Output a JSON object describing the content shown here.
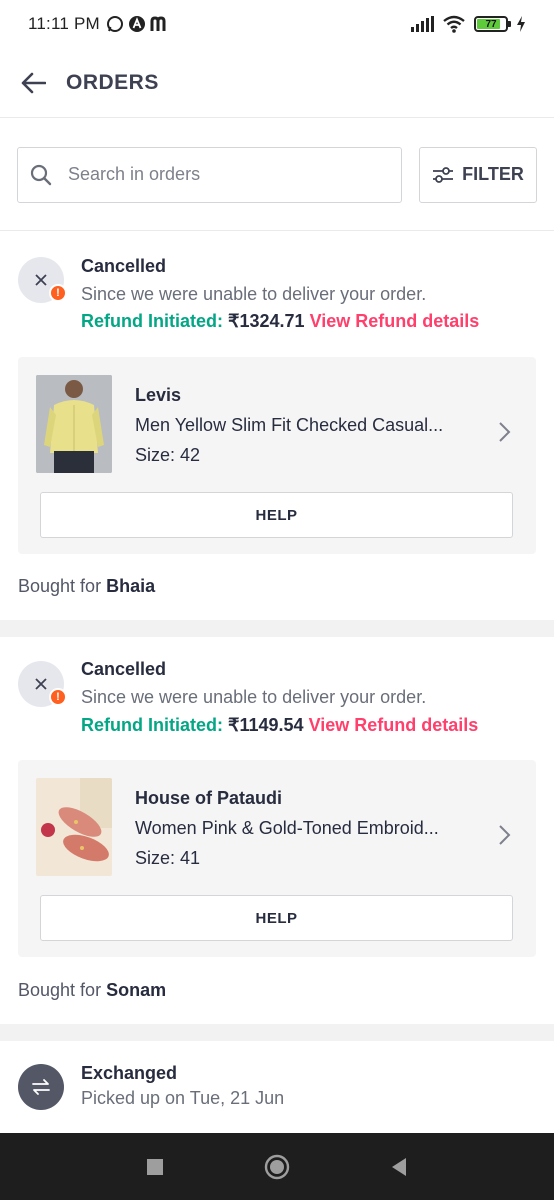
{
  "status_bar": {
    "time": "11:11 PM",
    "battery": "77"
  },
  "appbar": {
    "title": "ORDERS"
  },
  "search": {
    "placeholder": "Search in orders"
  },
  "filter": {
    "label": "FILTER"
  },
  "orders": [
    {
      "status": "Cancelled",
      "subtitle": "Since we were unable to deliver your order.",
      "refund_label": "Refund Initiated:",
      "refund_amount": "₹1324.71",
      "refund_link": "View Refund details",
      "brand": "Levis",
      "product": "Men Yellow Slim Fit Checked Casual...",
      "size": "Size: 42",
      "help": "HELP",
      "bought_for_label": "Bought for",
      "bought_for_name": "Bhaia"
    },
    {
      "status": "Cancelled",
      "subtitle": "Since we were unable to deliver your order.",
      "refund_label": "Refund Initiated:",
      "refund_amount": "₹1149.54",
      "refund_link": "View Refund details",
      "brand": "House of Pataudi",
      "product": "Women Pink & Gold-Toned Embroid...",
      "size": "Size: 41",
      "help": "HELP",
      "bought_for_label": "Bought for",
      "bought_for_name": "Sonam"
    },
    {
      "status": "Exchanged",
      "subtitle": "Picked up on Tue, 21 Jun"
    }
  ],
  "colors": {
    "refund_green": "#03a685",
    "link_pink": "#ff3f6c",
    "alert_orange": "#ff5f1f"
  }
}
